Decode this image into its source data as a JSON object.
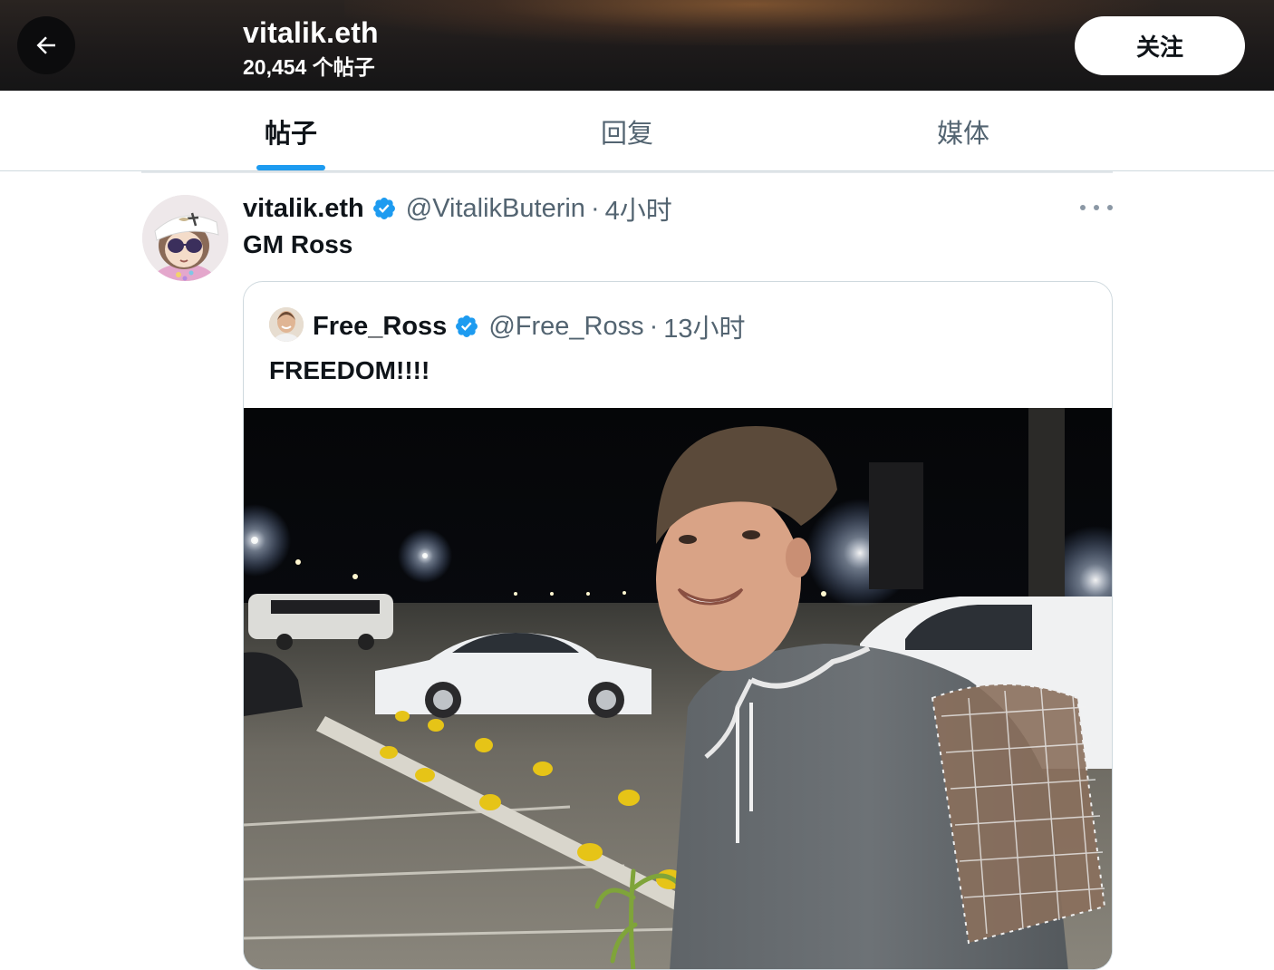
{
  "header": {
    "name": "vitalik.eth",
    "post_count": "20,454 个帖子",
    "follow_label": "关注"
  },
  "tabs": [
    {
      "label": "帖子",
      "active": true
    },
    {
      "label": "回复",
      "active": false
    },
    {
      "label": "媒体",
      "active": false
    }
  ],
  "tweet": {
    "name": "vitalik.eth",
    "handle": "@VitalikButerin",
    "separator": "·",
    "time": "4小时",
    "text": "GM Ross",
    "quote": {
      "name": "Free_Ross",
      "handle": "@Free_Ross",
      "separator": "·",
      "time": "13小时",
      "text": "FREEDOM!!!!"
    }
  },
  "colors": {
    "accent": "#1d9bf0",
    "header_bg": "#1d1a1a",
    "secondary_text": "#536471"
  },
  "icons": {
    "back": "arrow-left-icon",
    "verified": "verified-badge-icon",
    "more": "more-horizontal-icon"
  }
}
